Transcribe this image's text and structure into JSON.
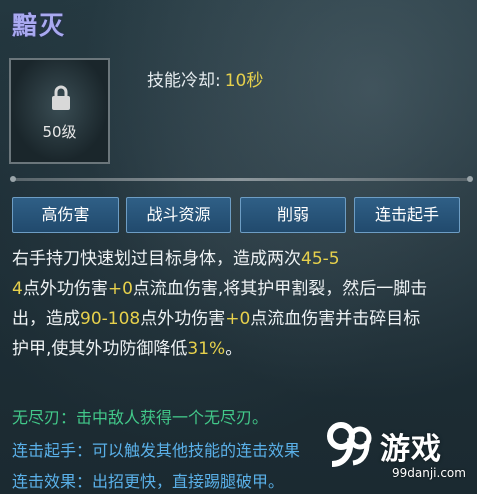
{
  "skill": {
    "name": "黯灭",
    "level_label": "50级",
    "cooldown_label": "技能冷却:",
    "cooldown_value": "10秒"
  },
  "tags": [
    "高伤害",
    "战斗资源",
    "削弱",
    "连击起手"
  ],
  "description": {
    "p1": "右手持刀快速划过目标身体，造成两次",
    "n1a": "45-5",
    "n1b": "4",
    "p2": "点外功伤害",
    "n2": "+0",
    "p3": "点流血伤害,将其护甲割裂，然后一脚击出，造成",
    "n3": "90-108",
    "p4": "点外功伤害",
    "n4": "+0",
    "p5": "点流血伤害并击碎目标护甲,使其外功防御降低",
    "n5": "31%",
    "p6": "。"
  },
  "notes": {
    "wujin": "无尽刃：击中敌人获得一个无尽刃。",
    "qishou": "连击起手：可以触发其他技能的连击效果",
    "xiaoguo": "连击效果：出招更快，直接踢腿破甲。"
  },
  "watermark": {
    "brand": "游戏",
    "site": "99danji.com"
  },
  "colors": {
    "title": "#a9a9f0",
    "number": "#e6d04c",
    "green_text": "#42c98a",
    "blue_text": "#5ab0e8",
    "tag_bg": "#2a5679"
  },
  "icons": {
    "lock": "lock-icon",
    "watermark_logo": "99-logo-icon"
  }
}
